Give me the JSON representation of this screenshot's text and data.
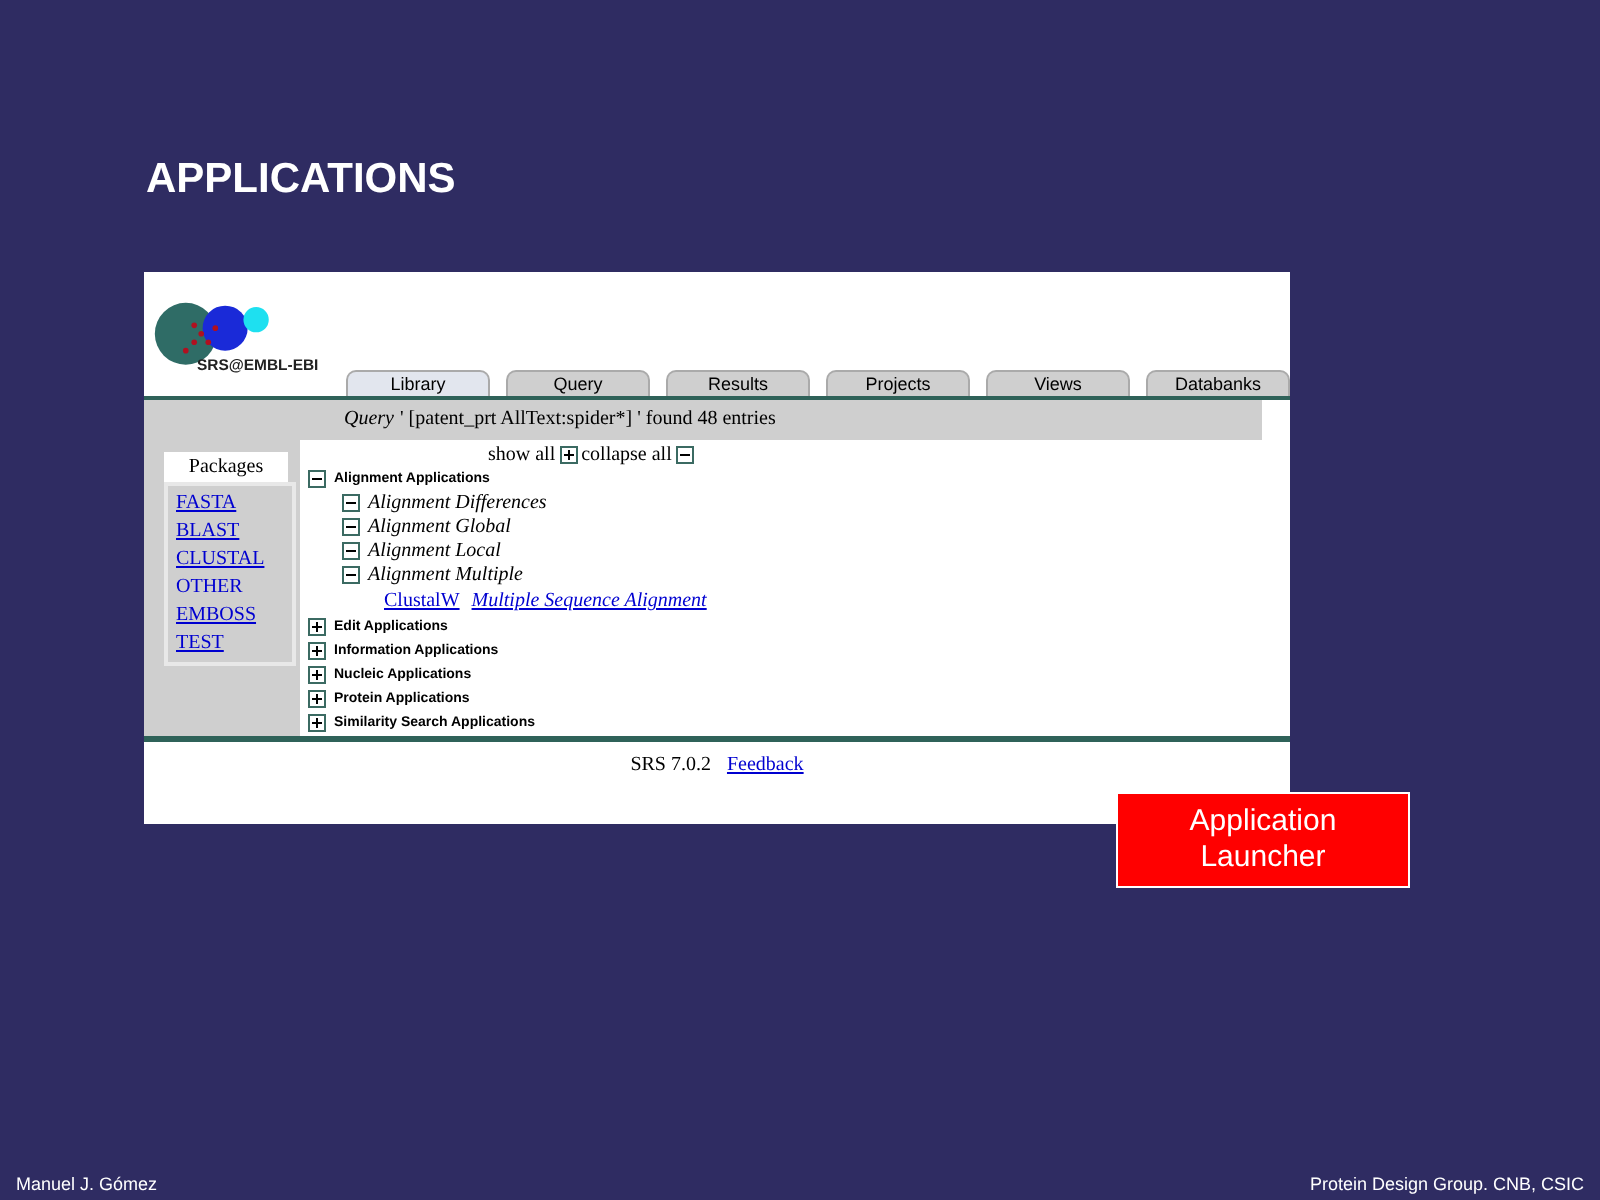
{
  "slide": {
    "title": "APPLICATIONS",
    "author": "Manuel J. Gómez",
    "affiliation": "Protein Design Group. CNB, CSIC"
  },
  "callout": "Application Launcher",
  "srs": {
    "logo_text": "SRS@EMBL-EBI",
    "tabs": [
      {
        "label": "Library",
        "selected": true
      },
      {
        "label": "Query",
        "selected": false
      },
      {
        "label": "Results",
        "selected": false
      },
      {
        "label": "Projects",
        "selected": false
      },
      {
        "label": "Views",
        "selected": false
      },
      {
        "label": "Databanks",
        "selected": false
      }
    ],
    "query_label": "Query",
    "query_text": "' [patent_prt  AllText:spider*] ' found 48 entries",
    "packages_title": "Packages",
    "packages": [
      {
        "label": "FASTA",
        "link": true
      },
      {
        "label": "BLAST",
        "link": true
      },
      {
        "label": "CLUSTAL",
        "link": true
      },
      {
        "label": "OTHER",
        "link": false
      },
      {
        "label": "EMBOSS",
        "link": true
      },
      {
        "label": "TEST",
        "link": true
      }
    ],
    "show_all": "show all",
    "collapse_all": "collapse all",
    "tree": [
      {
        "label": "Alignment Applications",
        "expanded": true,
        "children": [
          {
            "label": "Alignment Differences",
            "expanded": true
          },
          {
            "label": "Alignment Global",
            "expanded": true
          },
          {
            "label": "Alignment Local",
            "expanded": true
          },
          {
            "label": "Alignment Multiple",
            "expanded": true,
            "links": [
              {
                "label": "ClustalW",
                "kind": "name"
              },
              {
                "label": "Multiple Sequence Alignment",
                "kind": "description"
              }
            ]
          }
        ]
      },
      {
        "label": "Edit Applications",
        "expanded": false
      },
      {
        "label": "Information Applications",
        "expanded": false
      },
      {
        "label": "Nucleic Applications",
        "expanded": false
      },
      {
        "label": "Protein Applications",
        "expanded": false
      },
      {
        "label": "Similarity Search Applications",
        "expanded": false
      }
    ],
    "version": "SRS 7.0.2",
    "feedback": "Feedback"
  }
}
